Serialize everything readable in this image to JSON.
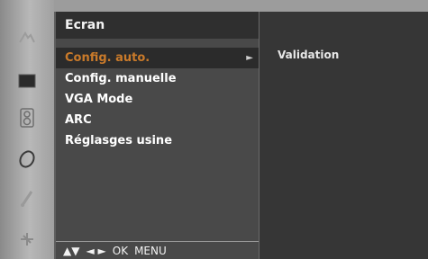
{
  "menu": {
    "title": "Ecran",
    "items": [
      {
        "label": "Config. auto.",
        "selected": true,
        "has_submenu": true
      },
      {
        "label": "Config. manuelle"
      },
      {
        "label": "VGA Mode"
      },
      {
        "label": "ARC"
      },
      {
        "label": "Réglasges usine"
      }
    ],
    "submenu_arrow": "►"
  },
  "submenu": {
    "item": "Validation"
  },
  "nav": {
    "updown": "▲▼",
    "leftright": "◄ ►",
    "ok": "OK",
    "menu": "MENU"
  },
  "icons": [
    "picture-icon",
    "screen-icon",
    "audio-icon",
    "time-icon",
    "special-icon",
    "settings-icon"
  ],
  "colors": {
    "selected_text": "#c97a2a",
    "panel": "#494949",
    "title_bar": "#2f2f2f"
  }
}
